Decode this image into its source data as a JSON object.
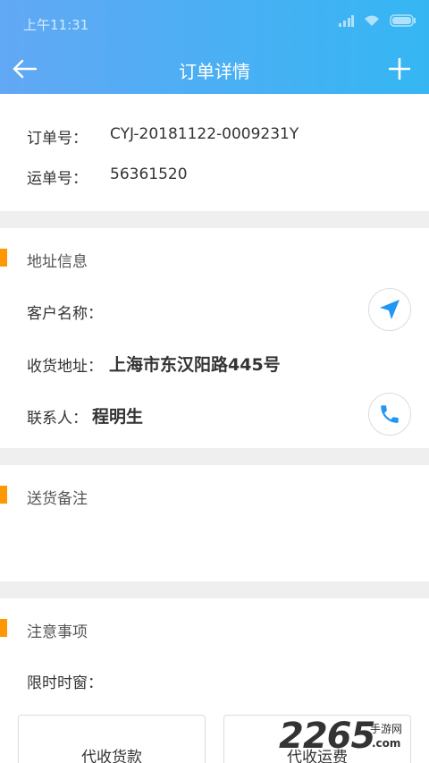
{
  "status_bar": {
    "time": "上午11:31"
  },
  "nav": {
    "title": "订单详情",
    "back_icon": "arrow-left-icon",
    "add_icon": "plus-icon"
  },
  "order": {
    "order_no_label": "订单号：",
    "order_no_value": "CYJ-20181122-0009231Y",
    "waybill_label": "运单号：",
    "waybill_value": "56361520"
  },
  "address": {
    "section_title": "地址信息",
    "customer_label": "客户名称：",
    "customer_value": "",
    "ship_addr_label": "收货地址：",
    "ship_addr_value": "上海市东汉阳路445号",
    "contact_label": "联系人：",
    "contact_value": "程明生",
    "navigate_icon": "navigation-arrow-icon",
    "phone_icon": "phone-icon"
  },
  "delivery_note": {
    "section_title": "送货备注",
    "content": ""
  },
  "notes": {
    "section_title": "注意事项",
    "time_window_label": "限时时窗：",
    "collect_goods_label": "代收货款",
    "collect_freight_label": "代收运费"
  },
  "watermark": {
    "number": "2265",
    "text": "手游网",
    "domain": ".com"
  },
  "colors": {
    "header_start": "#62a8f4",
    "header_end": "#35b6f3",
    "accent_marker": "#ff9800",
    "icon_blue": "#2196f3"
  }
}
